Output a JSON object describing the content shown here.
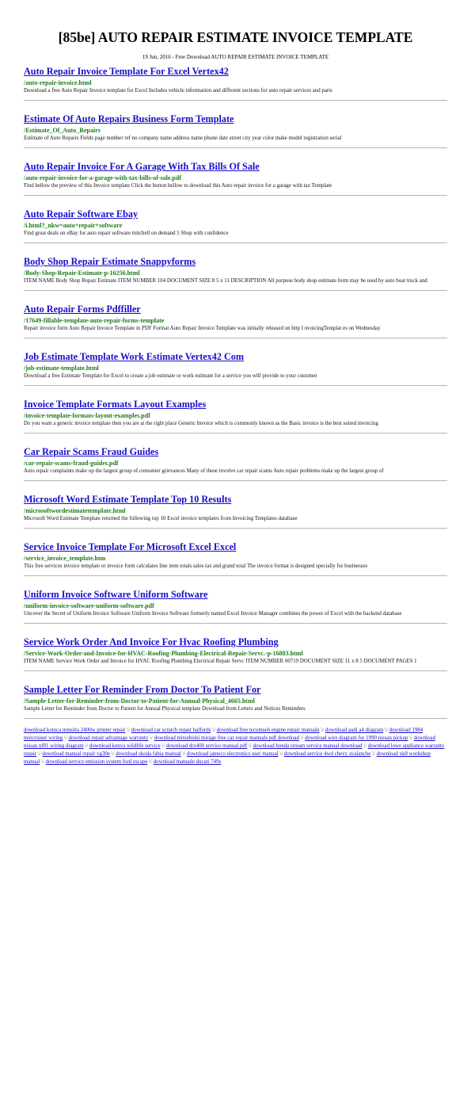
{
  "page": {
    "title": "[85be] AUTO REPAIR ESTIMATE INVOICE TEMPLATE",
    "subtitle": "19 Jun, 2016 - Free Download AUTO REPAIR ESTIMATE INVOICE TEMPLATE"
  },
  "results": [
    {
      "title": "Auto Repair Invoice Template For Excel Vertex42",
      "url": "/auto-repair-invoice.html",
      "description": "Download a free Auto Repair Invoice template for Excel Includes vehicle information and different sections for auto repair services and parts"
    },
    {
      "title": "Estimate Of Auto Repairs Business Form Template",
      "url": "/Estimate_Of_Auto_Repairs",
      "description": "Estimate of Auto Repairs Fields page number ref no company name address name phone date street city year color make model registration serial"
    },
    {
      "title": "Auto Repair Invoice For A Garage With Tax Bills Of Sale",
      "url": "/auto-repair-invoice-for-a-garage-with-tax-bills-of-sale.pdf",
      "description": "Find bellow the preview of this Invoice template Click the button bellow to download this Auto repair invoice for a garage with tax Template"
    },
    {
      "title": "Auto Repair Software Ebay",
      "url": "/i.html?_nkw=auto+repair+software",
      "description": "Find great deals on eBay for auto repair software mitchell on demand 5 Shop with confidence"
    },
    {
      "title": "Body Shop Repair Estimate Snappyforms",
      "url": "/Body-Shop-Repair-Estimate-p-16256.html",
      "description": "ITEM NAME Body Shop Repair Estimate ITEM NUMBER 104 DOCUMENT SIZE 8 5 x 11 DESCRIPTION All purpose body shop estimate form may be used by auto boat truck and"
    },
    {
      "title": "Auto Repair Forms Pdffiller",
      "url": "/17649-fillable-template-auto-repair-forms-template",
      "description": "Repair invoice form Auto Repair Invoice Template in PDF Format Auto Repair Invoice Template was initially released on http I nvoicingTemplat es on Wednesday"
    },
    {
      "title": "Job Estimate Template Work Estimate Vertex42 Com",
      "url": "/job-estimate-template.html",
      "description": "Download a free Estimate Template for Excel to create a job estimate or work estimate for a service you will provide to your customer"
    },
    {
      "title": "Invoice Template Formats Layout Examples",
      "url": "/invoice-template-formats-layout-examples.pdf",
      "description": "Do you want a generic invoice template then you are at the right place Generic Invoice which is commonly known as the Basic invoice is the best suited invoicing"
    },
    {
      "title": "Car Repair Scams Fraud Guides",
      "url": "/car-repair-scams-fraud-guides.pdf",
      "description": "Auto repair complaints make up the largest group of consumer grievances Many of these involve car repair scams Auto repair problems make up the largest group of"
    },
    {
      "title": "Microsoft Word Estimate Template Top 10 Results",
      "url": "/microsoftwordestimatetemplate.html",
      "description": "Microsoft Word Estimate Template returned the following top 10 Excel invoice templates from Invoicing Templates database"
    },
    {
      "title": "Service Invoice Template For Microsoft Excel Excel",
      "url": "/service_invoice_template.htm",
      "description": "This free services invoice template or invoice form calculates line item totals sales tax and grand total The invoice format is designed specially for businesses"
    },
    {
      "title": "Uniform Invoice Software Uniform Software",
      "url": "/uniform-invoice-software-uniform-software.pdf",
      "description": "Uncover the Secret of Uniform Invoice Software Uniform Invoice Software formerly named Excel Invoice Manager combines the power of Excel with the backend database"
    },
    {
      "title": "Service Work Order And Invoice For Hvac Roofing Plumbing",
      "url": "/Service-Work-Order-and-Invoice-for-HVAC-Roofing-Plumbing-Electrical-Repair-Servc.-p-16883.html",
      "description": "ITEM NAME Service Work Order and Invoice for HVAC Roofing Plumbing Electrical Repair Servc ITEM NUMBER 00719 DOCUMENT SIZE 11 x 8 5 DOCUMENT PAGES 1"
    },
    {
      "title": "Sample Letter For Reminder From Doctor To Patient For",
      "url": "/Sample-Letter-for-Reminder-from-Doctor-to-Patient-for-Annual-Physical_4665.html",
      "description": "Sample Letter for Reminder from Doctor to Patient for Annual Physical template Download from Letters and Notices Reminders"
    }
  ],
  "footer": {
    "separator": "\\/",
    "links": [
      "download konica minolta 2400w printer repair",
      "download car scratch repair halfords",
      "download free tecumseh engine repair manuals",
      "download audi a4 diagram",
      "download 1984 mercruiser wiring",
      "download repair advantage warranty",
      "download mitsubishi mirage free car repair manuals pdf download",
      "download wire diagram for 1990 nissan pickup",
      "download nissan nf01 wiring diagram",
      "download kenya wildlife service",
      "download drz400 service manual pdf",
      "download honda stream service manual download",
      "download lowe appliance warranty repair",
      "download manual repair vg30e",
      "download skoda fabia manual",
      "download jameco electronics user manual",
      "download service 4wd chevy avalanche",
      "download xk8 workshop manual",
      "download service emission system ford escape",
      "download manuale ducati 749s"
    ]
  },
  "colors": {
    "link": "#1a0dcc",
    "url": "#1b7a1b",
    "divider": "#b4b4b4"
  }
}
